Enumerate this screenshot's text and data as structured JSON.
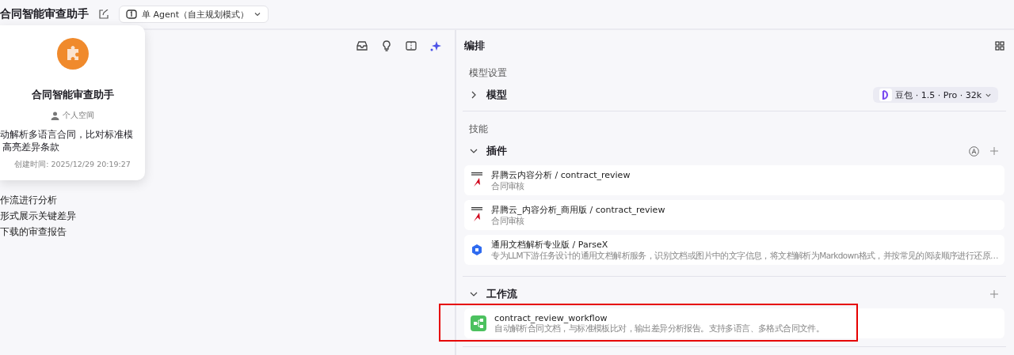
{
  "header": {
    "title": "合同智能审查助手",
    "mode": "单 Agent（自主规划模式）"
  },
  "popover": {
    "name": "合同智能审查助手",
    "space": "个人空间",
    "description": [
      "动解析多语言合同，比对标准模",
      "高亮差异条款"
    ],
    "created": "创建时间: 2025/12/29 20:19:27"
  },
  "prompt_lines": [
    "作流进行分析",
    "形式展示关键差异",
    "下载的审查报告"
  ],
  "panel": {
    "title": "编排",
    "model_section": {
      "label": "模型设置",
      "group": "模型",
      "expanded": false,
      "model": "豆包 · 1.5 · Pro · 32k"
    },
    "skills_label": "技能",
    "groups": [
      {
        "title": "插件",
        "expanded": true,
        "auto": true,
        "items": [
          {
            "kind": "ascend",
            "name": "昇腾云内容分析 / contract_review",
            "description": "合同审核"
          },
          {
            "kind": "ascend",
            "name": "昇腾云_内容分析_商用版 / contract_review",
            "description": "合同审核"
          },
          {
            "kind": "parse",
            "name": "通用文档解析专业版 / ParseX",
            "description": "专为LLM下游任务设计的通用文档解析服务，识别文档或图片中的文字信息，将文档解析为Markdown格式，并按常见的阅读顺序进行还原…"
          }
        ]
      },
      {
        "title": "工作流",
        "expanded": true,
        "items": [
          {
            "kind": "workflow",
            "name": "contract_review_workflow",
            "description": "自动解析合同文档，与标准模板比对，输出差异分析报告。支持多语言、多格式合同文件。",
            "highlighted": true
          }
        ]
      }
    ]
  }
}
